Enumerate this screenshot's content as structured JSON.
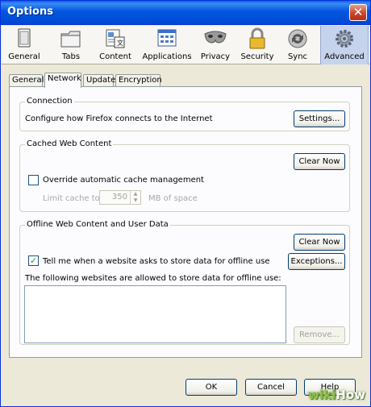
{
  "window": {
    "title": "Options",
    "close_glyph": "✕"
  },
  "toolbar": [
    {
      "label": "General",
      "icon": "general-icon"
    },
    {
      "label": "Tabs",
      "icon": "tabs-icon"
    },
    {
      "label": "Content",
      "icon": "content-icon"
    },
    {
      "label": "Applications",
      "icon": "applications-icon"
    },
    {
      "label": "Privacy",
      "icon": "privacy-mask-icon"
    },
    {
      "label": "Security",
      "icon": "lock-icon"
    },
    {
      "label": "Sync",
      "icon": "sync-icon"
    },
    {
      "label": "Advanced",
      "icon": "gear-icon",
      "selected": true
    }
  ],
  "tabs": [
    {
      "label": "General"
    },
    {
      "label": "Network",
      "selected": true
    },
    {
      "label": "Update"
    },
    {
      "label": "Encryption"
    }
  ],
  "connection": {
    "title": "Connection",
    "description": "Configure how Firefox connects to the Internet",
    "settings_label": "Settings..."
  },
  "cache": {
    "title": "Cached Web Content",
    "clear_label": "Clear Now",
    "override_label": "Override automatic cache management",
    "override_checked": false,
    "limit_label": "Limit cache to",
    "limit_value": "350",
    "unit_label": "MB of space"
  },
  "offline": {
    "title": "Offline Web Content and User Data",
    "clear_label": "Clear Now",
    "tell_label": "Tell me when a website asks to store data for offline use",
    "tell_checked": true,
    "exceptions_label": "Exceptions...",
    "allowed_label": "The following websites are allowed to store data for offline use:",
    "remove_label": "Remove..."
  },
  "footer": {
    "ok_label": "OK",
    "cancel_label": "Cancel",
    "help_label": "Help"
  },
  "watermark": {
    "prefix": "wiki",
    "suffix": "How"
  },
  "colors": {
    "title_bar": "#0054e3",
    "selected_toolbar": "#c5d3ec",
    "window_bg": "#ece9d8"
  }
}
